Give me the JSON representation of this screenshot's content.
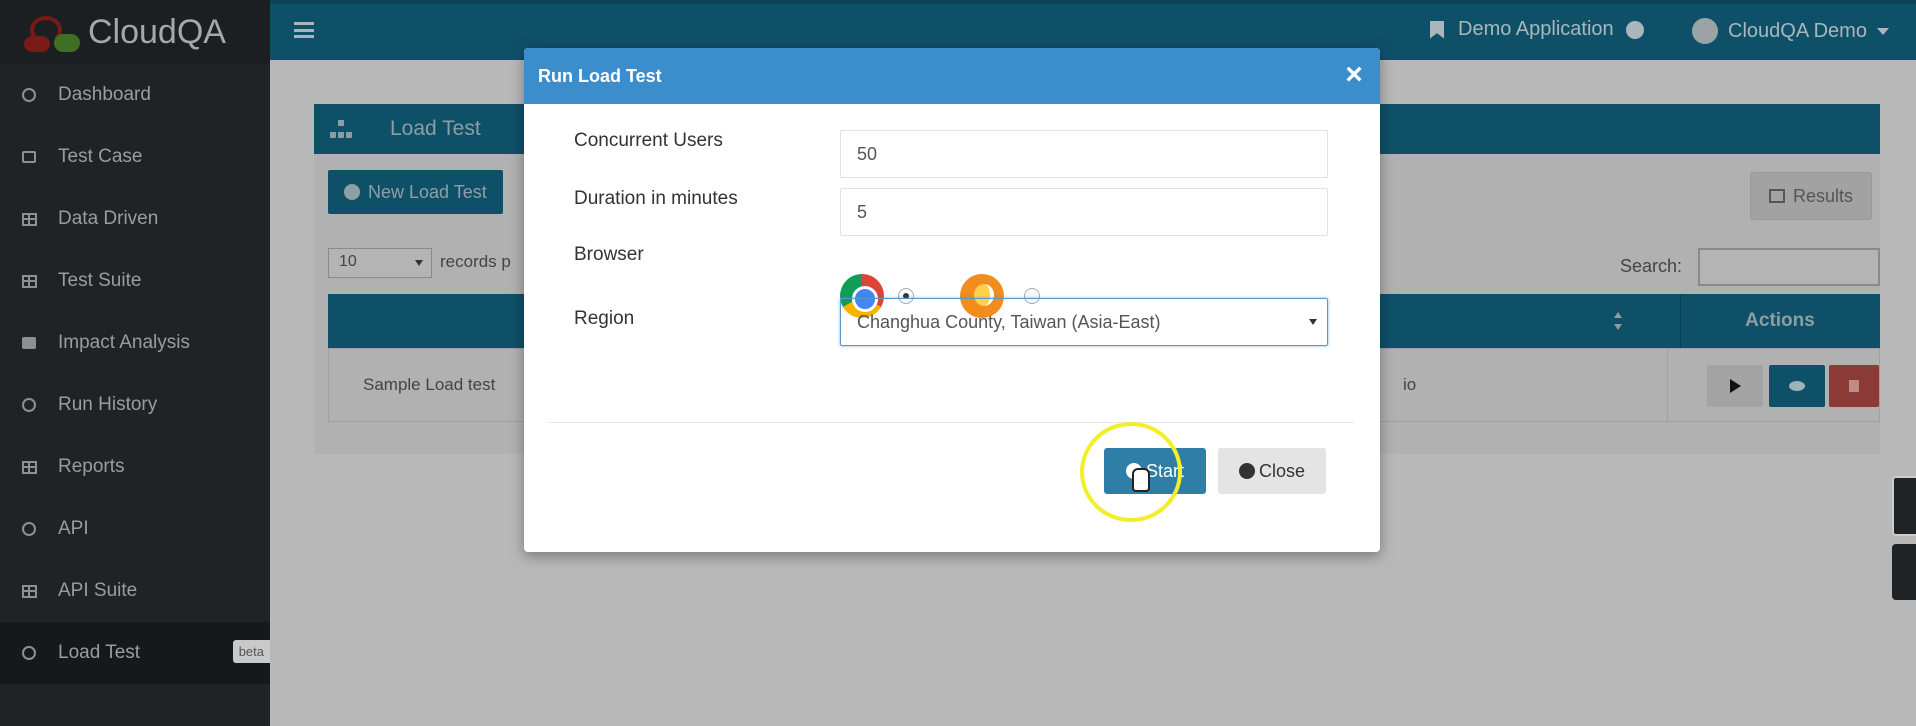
{
  "brand": {
    "name": "CloudQA"
  },
  "sidebar": {
    "items": [
      {
        "label": "Dashboard",
        "icon": "dashboard-icon"
      },
      {
        "label": "Test Case",
        "icon": "test-case-icon"
      },
      {
        "label": "Data Driven",
        "icon": "table-icon"
      },
      {
        "label": "Test Suite",
        "icon": "calendar-icon"
      },
      {
        "label": "Impact Analysis",
        "icon": "briefcase-icon"
      },
      {
        "label": "Run History",
        "icon": "clock-icon"
      },
      {
        "label": "Reports",
        "icon": "table-icon"
      },
      {
        "label": "API",
        "icon": "cogs-icon"
      },
      {
        "label": "API Suite",
        "icon": "calendar-icon"
      },
      {
        "label": "Load Test",
        "icon": "cogs-icon",
        "badge": "beta",
        "active": true
      }
    ]
  },
  "topbar": {
    "app_name": "Demo Application",
    "user_name": "CloudQA Demo"
  },
  "page": {
    "panel_title": "Load Test",
    "new_button": "New Load Test",
    "results_button": "Results",
    "page_size": "10",
    "records_label": "records p",
    "search_label": "Search:",
    "actions_header": "Actions",
    "row": {
      "name": "Sample Load test",
      "tail": "io"
    }
  },
  "modal": {
    "title": "Run Load Test",
    "close_glyph": "×",
    "concurrent_users_label": "Concurrent Users",
    "concurrent_users_value": "50",
    "duration_label": "Duration in minutes",
    "duration_value": "5",
    "browser_label": "Browser",
    "browsers": [
      {
        "name": "chrome",
        "selected": true
      },
      {
        "name": "firefox",
        "selected": false
      }
    ],
    "region_label": "Region",
    "region_value": "Changhua County, Taiwan (Asia-East)",
    "start_button": "Start",
    "close_button": "Close"
  },
  "colors": {
    "header_blue": "#3c8dcc",
    "primary_dark": "#0f5069",
    "sidebar_bg": "#1f2326",
    "highlight": "#f2ee2a"
  }
}
